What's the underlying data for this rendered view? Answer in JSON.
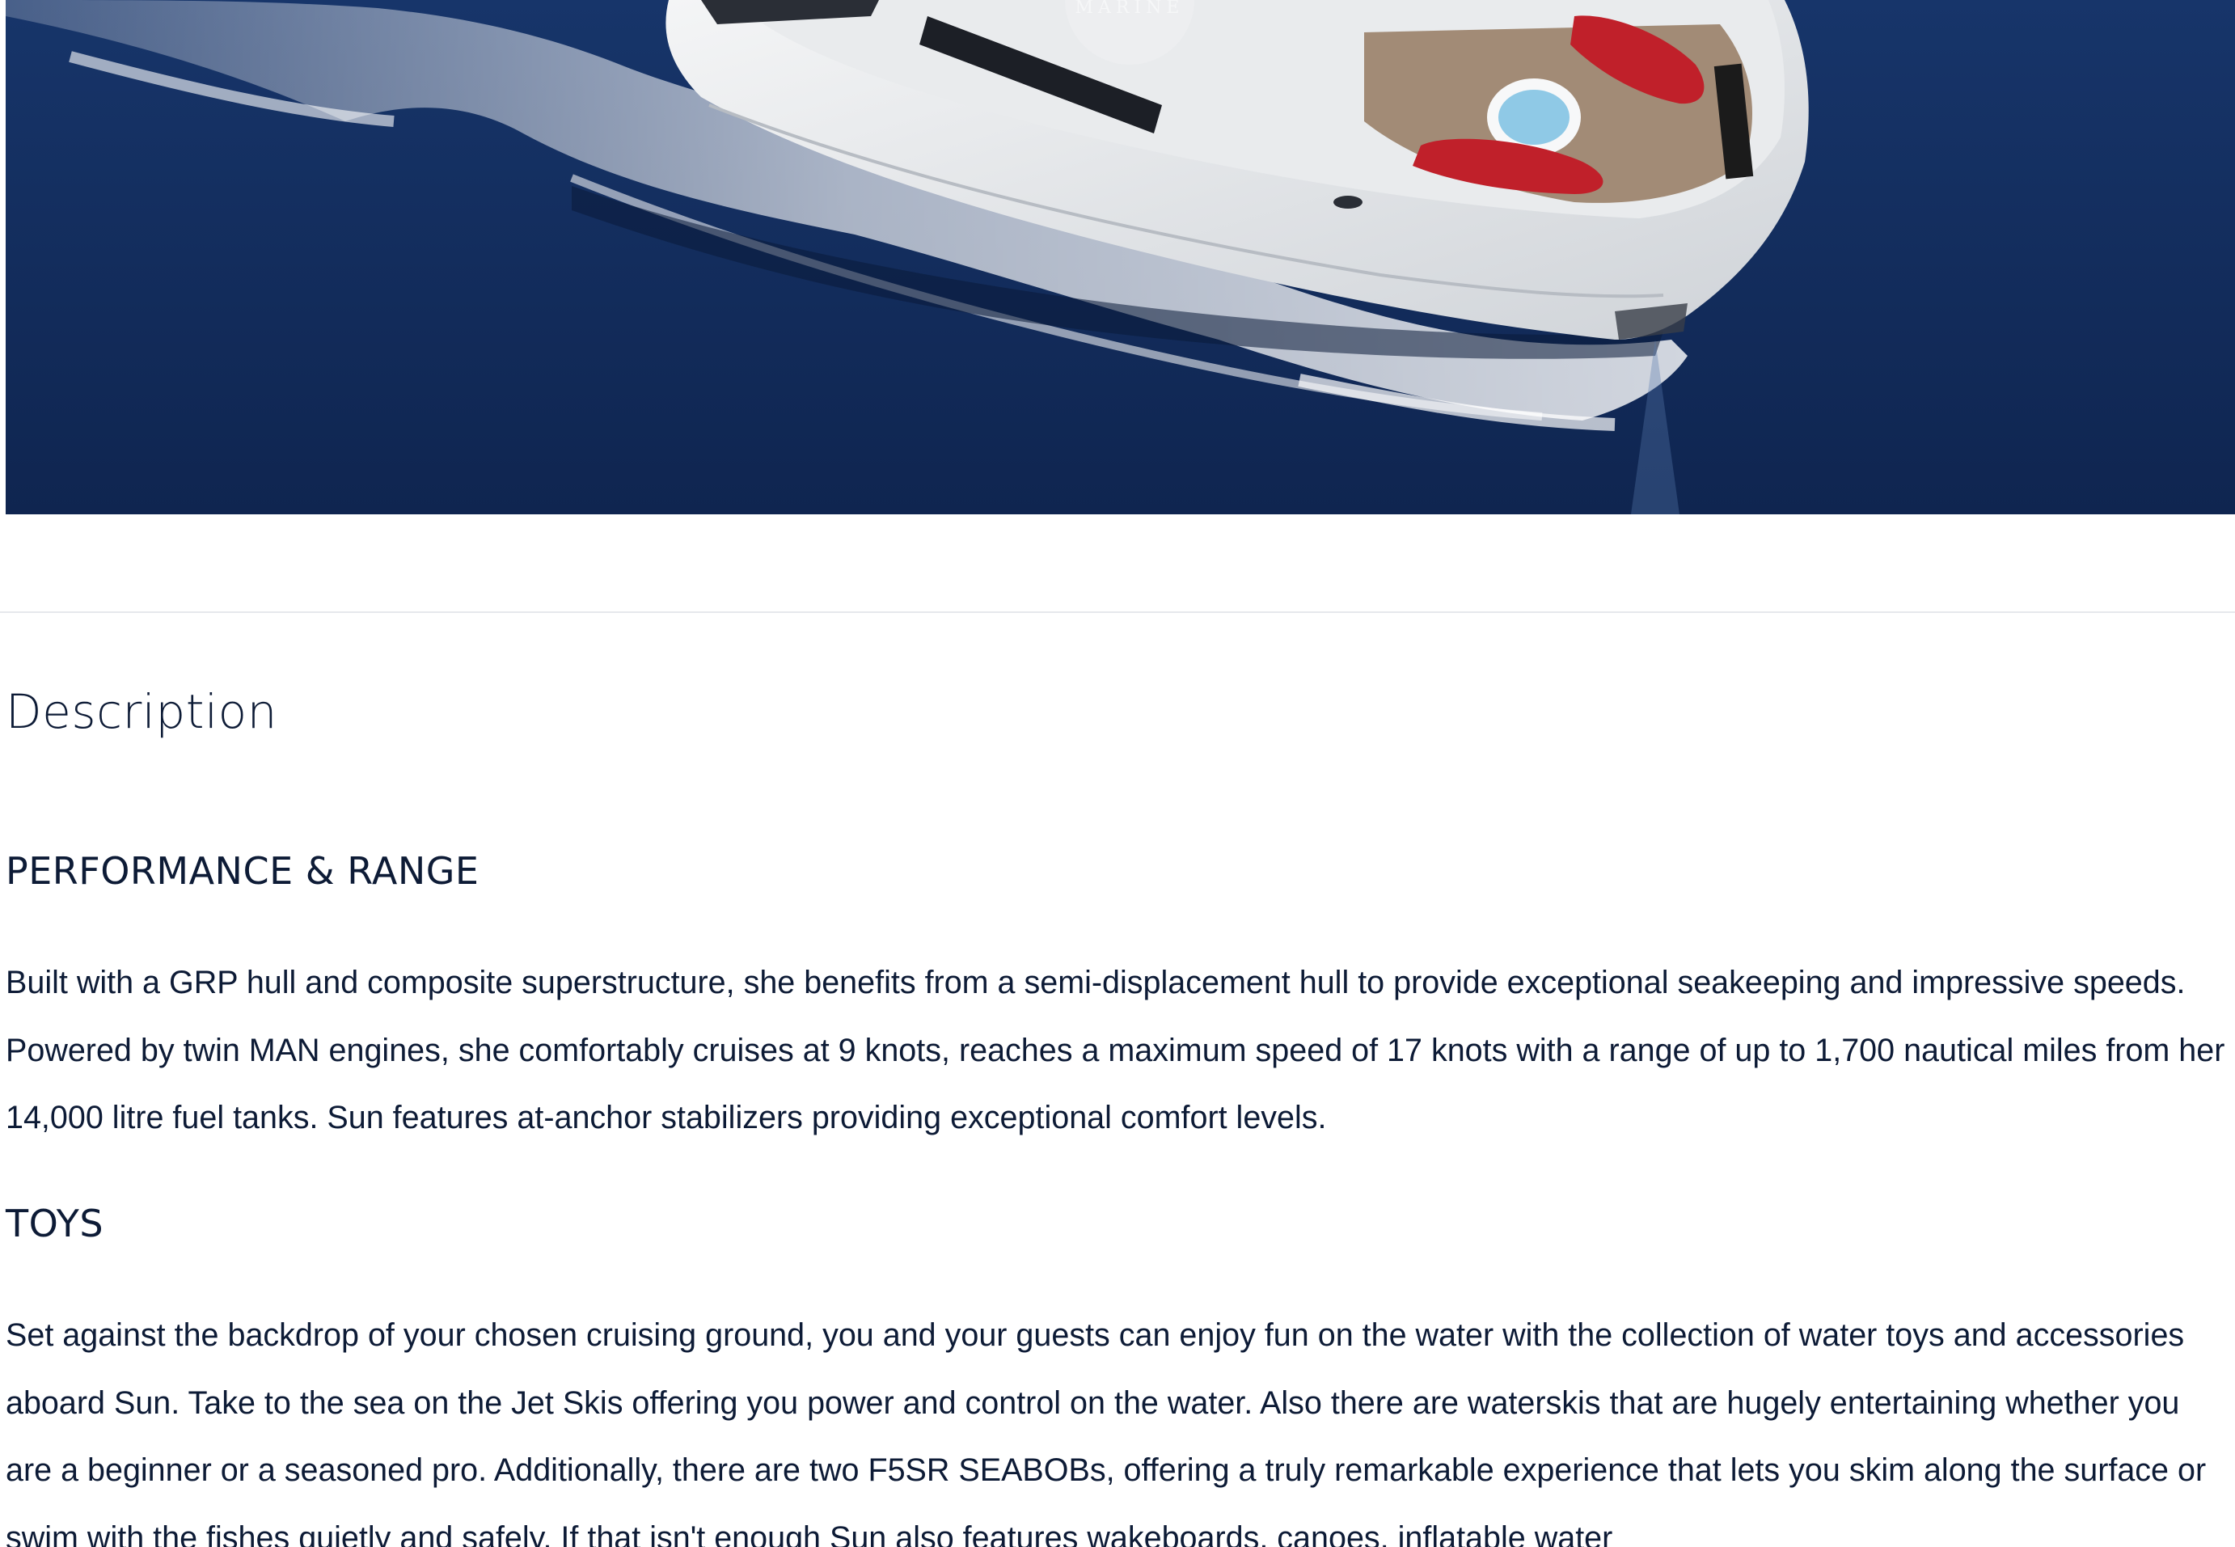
{
  "hero": {
    "image_alt": "Aerial view of motor yacht Sun cruising on deep blue sea",
    "watermark_text": "MARINE"
  },
  "description": {
    "title": "Description",
    "sections": [
      {
        "heading": "PERFORMANCE & RANGE",
        "body": "Built with a GRP hull and composite superstructure, she benefits from a semi-displacement hull to provide exceptional seakeeping and impressive speeds. Powered by twin MAN engines, she comfortably cruises at 9 knots, reaches a maximum speed of 17 knots with a range of up to 1,700 nautical miles from her 14,000 litre fuel tanks. Sun features at-anchor stabilizers providing exceptional comfort levels."
      },
      {
        "heading": "TOYS",
        "body": "Set against the backdrop of your chosen cruising ground, you and your guests can enjoy fun on the water with the collection of water toys and accessories aboard Sun. Take to the sea on the Jet Skis offering you power and control on the water. Also there are waterskis that are hugely entertaining whether you are a beginner or a seasoned pro. Additionally, there are two F5SR SEABOBs, offering a truly remarkable experience that lets you skim along the surface or swim with the fishes quietly and safely. If that isn't enough Sun also features wakeboards, canoes, inflatable water"
      }
    ]
  },
  "colors": {
    "text": "#0d1b36",
    "sea": "#142e5c",
    "divider": "#e6e8ec"
  }
}
